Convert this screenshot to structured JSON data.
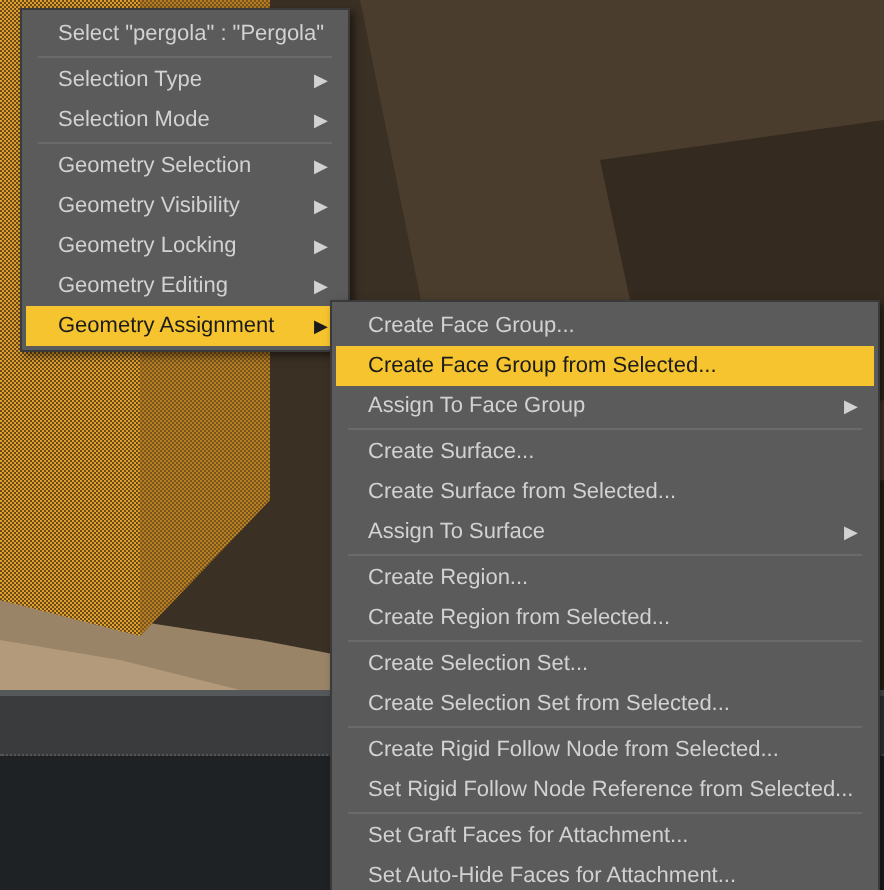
{
  "context_menu": {
    "groups": [
      [
        {
          "label": "Select \"pergola\" : \"Pergola\"",
          "submenu": false,
          "selected": false
        }
      ],
      [
        {
          "label": "Selection Type",
          "submenu": true,
          "selected": false
        },
        {
          "label": "Selection Mode",
          "submenu": true,
          "selected": false
        }
      ],
      [
        {
          "label": "Geometry Selection",
          "submenu": true,
          "selected": false
        },
        {
          "label": "Geometry Visibility",
          "submenu": true,
          "selected": false
        },
        {
          "label": "Geometry Locking",
          "submenu": true,
          "selected": false
        },
        {
          "label": "Geometry Editing",
          "submenu": true,
          "selected": false
        },
        {
          "label": "Geometry Assignment",
          "submenu": true,
          "selected": true
        }
      ]
    ],
    "arrow": "▶"
  },
  "submenu": {
    "groups": [
      [
        {
          "label": "Create Face Group...",
          "submenu": false,
          "selected": false
        },
        {
          "label": "Create Face Group from Selected...",
          "submenu": false,
          "selected": true
        },
        {
          "label": "Assign To Face Group",
          "submenu": true,
          "selected": false
        }
      ],
      [
        {
          "label": "Create Surface...",
          "submenu": false,
          "selected": false
        },
        {
          "label": "Create Surface from Selected...",
          "submenu": false,
          "selected": false
        },
        {
          "label": "Assign To Surface",
          "submenu": true,
          "selected": false
        }
      ],
      [
        {
          "label": "Create Region...",
          "submenu": false,
          "selected": false
        },
        {
          "label": "Create Region from Selected...",
          "submenu": false,
          "selected": false
        }
      ],
      [
        {
          "label": "Create Selection Set...",
          "submenu": false,
          "selected": false
        },
        {
          "label": "Create Selection Set from Selected...",
          "submenu": false,
          "selected": false
        }
      ],
      [
        {
          "label": "Create Rigid Follow Node from Selected...",
          "submenu": false,
          "selected": false
        },
        {
          "label": "Set Rigid Follow Node Reference from Selected...",
          "submenu": false,
          "selected": false
        }
      ],
      [
        {
          "label": "Set Graft Faces for Attachment...",
          "submenu": false,
          "selected": false
        },
        {
          "label": "Set Auto-Hide Faces for Attachment...",
          "submenu": false,
          "selected": false
        }
      ]
    ],
    "arrow": "▶"
  }
}
